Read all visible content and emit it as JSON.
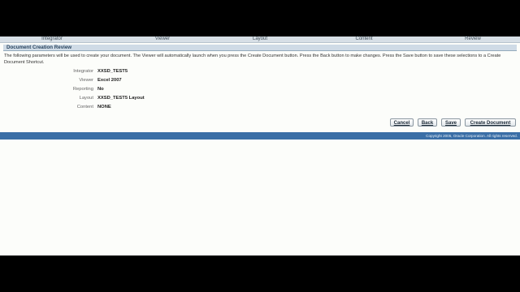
{
  "train": {
    "steps": [
      "Integrator",
      "Viewer",
      "Layout",
      "Content",
      "Review"
    ]
  },
  "header": {
    "title": "Document Creation Review"
  },
  "intro": "The following parameters will be used to create your document. The Viewer will automatically launch when you press the Create Document button. Press the Back button to make changes. Press the Save button to save these selections to a Create Document Shortcut.",
  "fields": [
    {
      "label": "Integrator",
      "value": "XXSD_TEST5"
    },
    {
      "label": "Viewer",
      "value": "Excel 2007"
    },
    {
      "label": "Reporting",
      "value": "No"
    },
    {
      "label": "Layout",
      "value": "XXSD_TEST5 Layout"
    },
    {
      "label": "Content",
      "value": "NONE"
    }
  ],
  "buttons": {
    "cancel": "Cancel",
    "back": "Back",
    "save": "Save",
    "create": "Create Document"
  },
  "footer": {
    "copyright": "Copyright 2005, Oracle Corporation. All rights reserved."
  }
}
